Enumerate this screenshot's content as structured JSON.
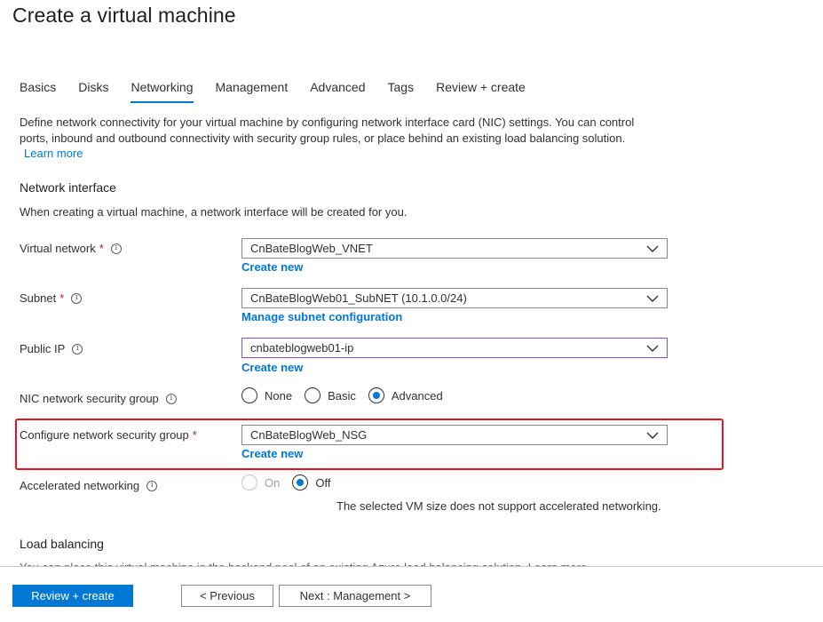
{
  "page_title": "Create a virtual machine",
  "tabs": [
    {
      "label": "Basics"
    },
    {
      "label": "Disks"
    },
    {
      "label": "Networking"
    },
    {
      "label": "Management"
    },
    {
      "label": "Advanced"
    },
    {
      "label": "Tags"
    },
    {
      "label": "Review + create"
    }
  ],
  "active_tab": "Networking",
  "description": "Define network connectivity for your virtual machine by configuring network interface card (NIC) settings. You can control ports, inbound and outbound connectivity with security group rules, or place behind an existing load balancing solution.",
  "learn_more": "Learn more",
  "network_interface": {
    "title": "Network interface",
    "subtitle": "When creating a virtual machine, a network interface will be created for you."
  },
  "fields": {
    "virtual_network": {
      "label": "Virtual network",
      "value": "CnBateBlogWeb_VNET",
      "link": "Create new"
    },
    "subnet": {
      "label": "Subnet",
      "value": "CnBateBlogWeb01_SubNET (10.1.0.0/24)",
      "link": "Manage subnet configuration"
    },
    "public_ip": {
      "label": "Public IP",
      "value": "cnbateblogweb01-ip",
      "link": "Create new"
    },
    "nic_nsg": {
      "label": "NIC network security group",
      "options": [
        "None",
        "Basic",
        "Advanced"
      ],
      "selected": "Advanced"
    },
    "configure_nsg": {
      "label": "Configure network security group",
      "value": "CnBateBlogWeb_NSG",
      "link": "Create new"
    },
    "accelerated": {
      "label": "Accelerated networking",
      "options": [
        "On",
        "Off"
      ],
      "selected": "Off",
      "note": "The selected VM size does not support accelerated networking."
    }
  },
  "required_marker": "*",
  "info_glyph": "i",
  "load_balancing": {
    "title": "Load balancing",
    "cutoff": "You can place this virtual machine in the backend pool of an existing Azure load balancing solution. Learn more"
  },
  "footer": {
    "review_create": "Review + create",
    "previous": "< Previous",
    "next": "Next : Management >"
  },
  "colors": {
    "accent": "#0078d4",
    "highlight": "#e81123",
    "required": "#a4262c"
  },
  "icons": {
    "dropdown": "chevron-down-icon",
    "info": "info-icon"
  }
}
